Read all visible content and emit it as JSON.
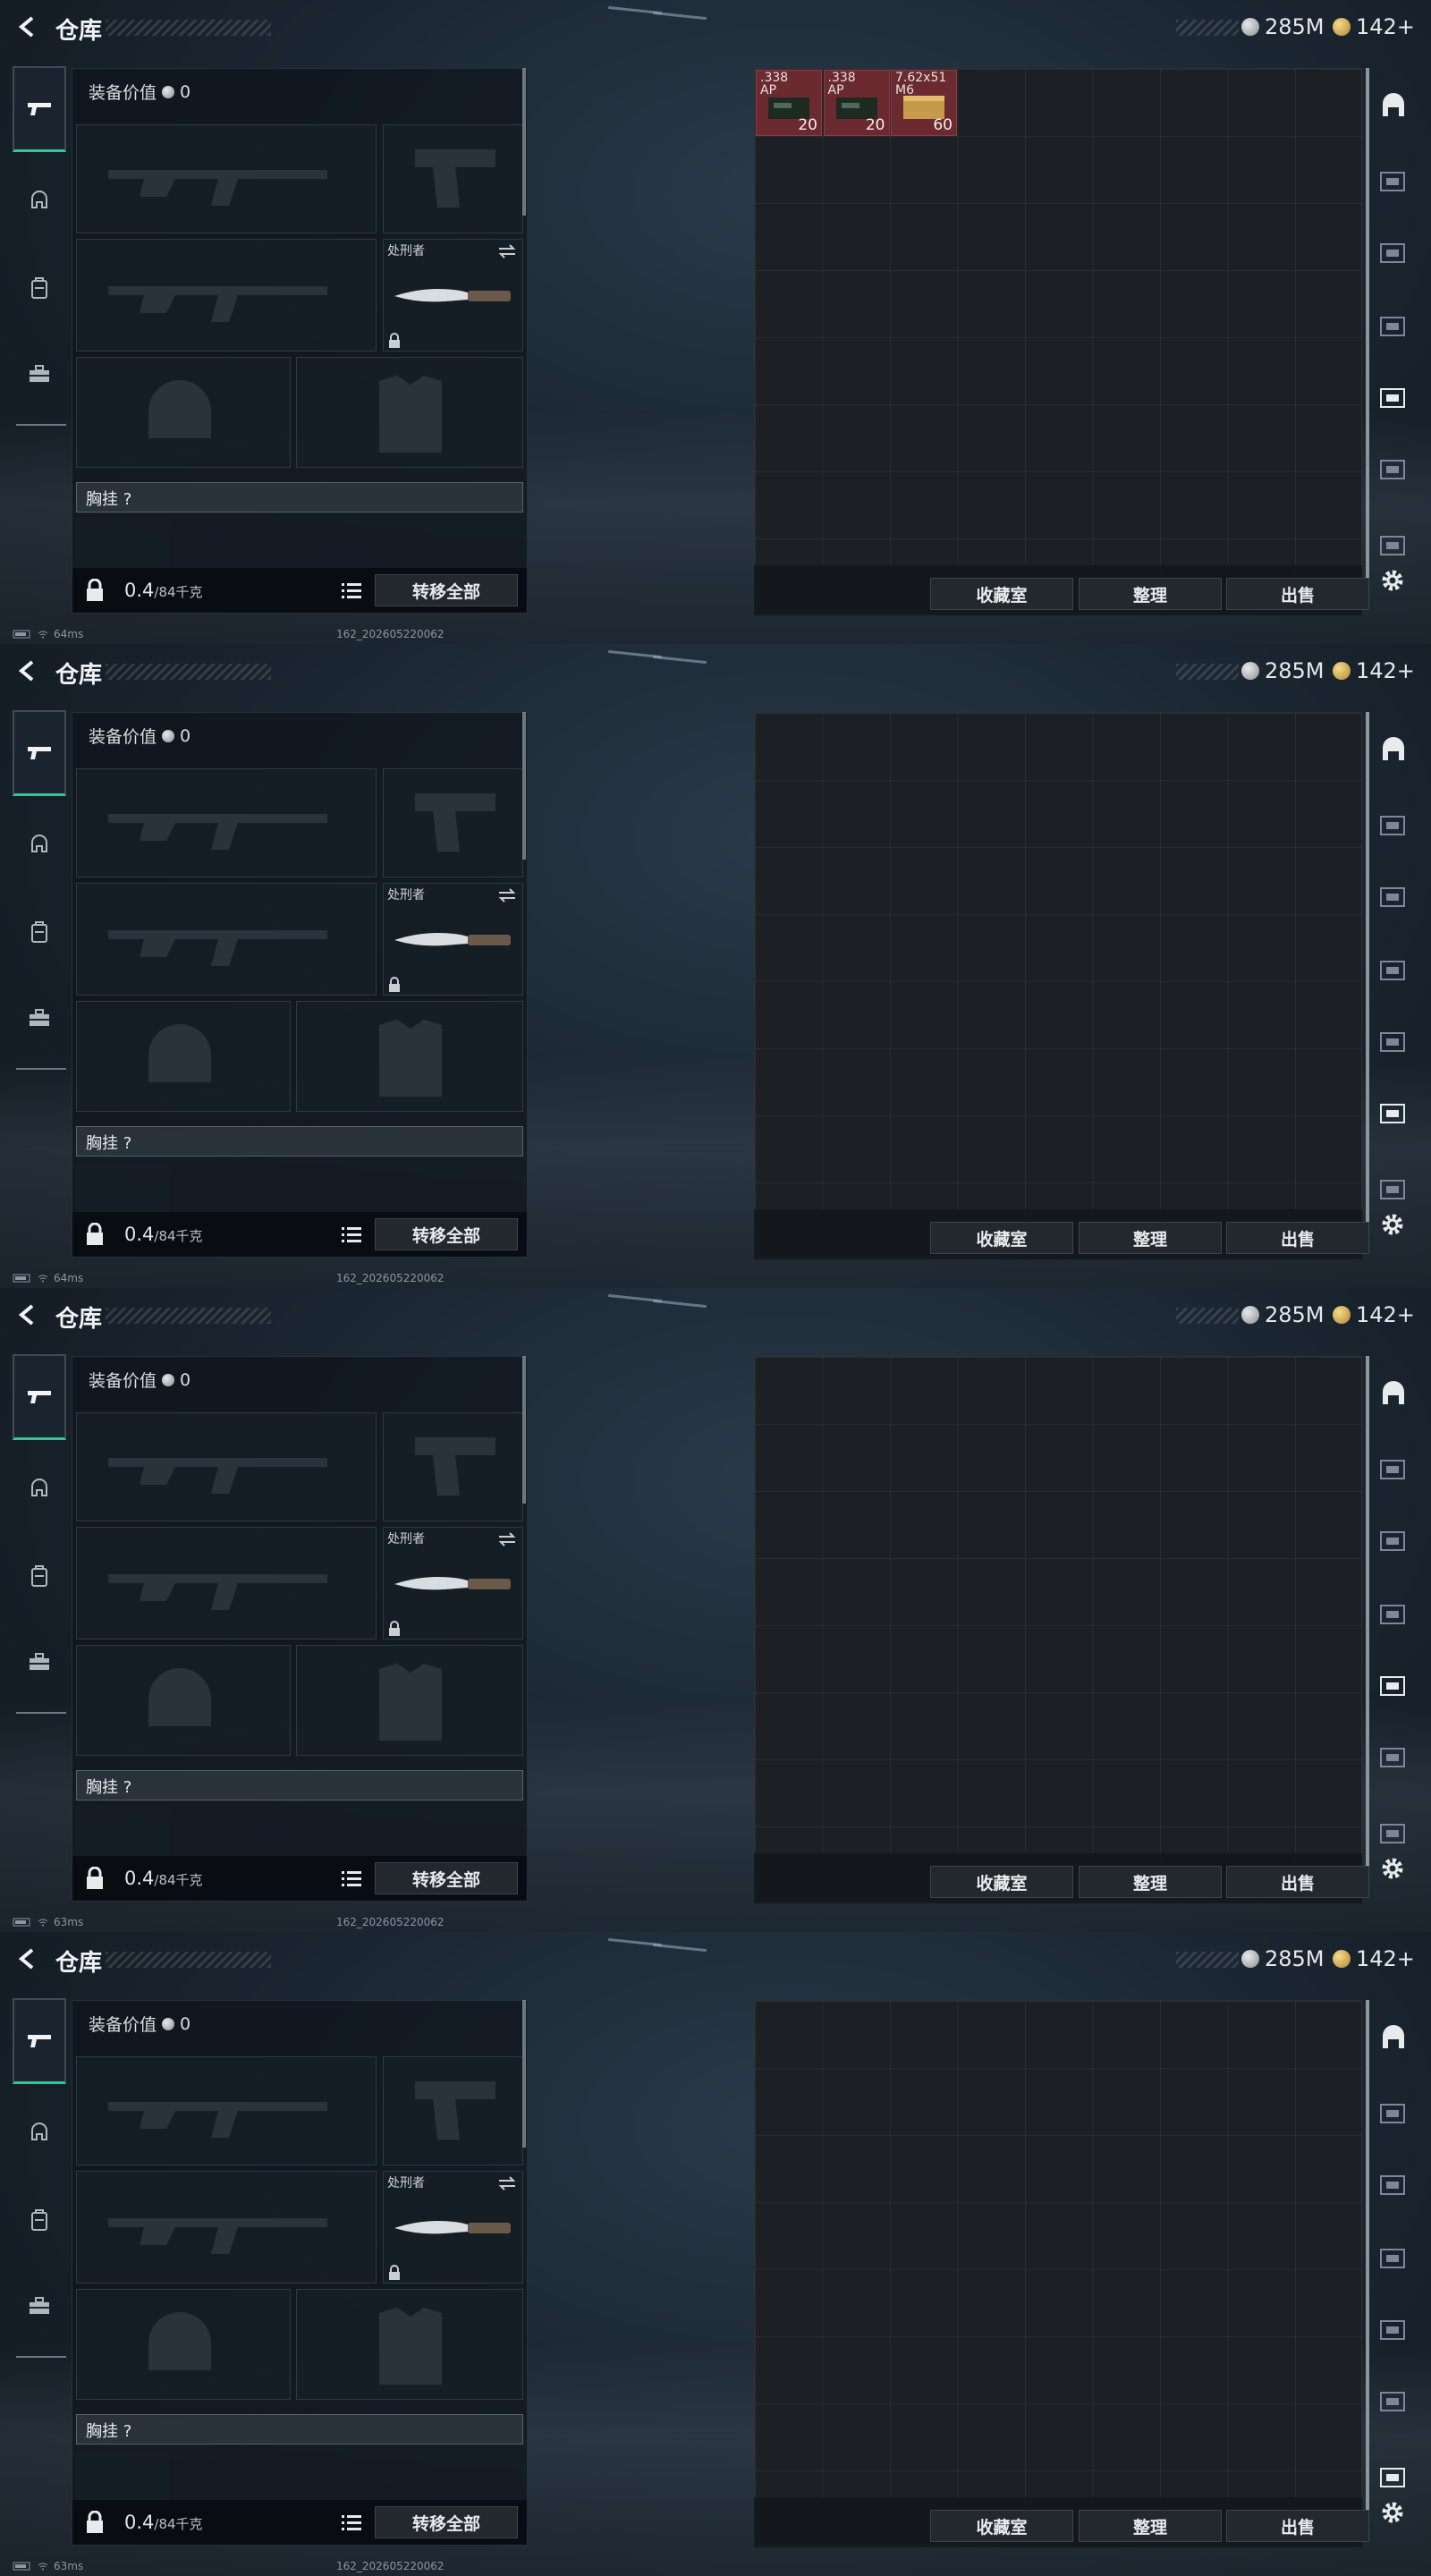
{
  "frames": [
    {
      "header": {
        "title": "仓库",
        "silver": "285M",
        "gold": "142+"
      },
      "loadout": {
        "equip_value_label": "装备价值",
        "equip_value": "0",
        "melee_label": "处刑者",
        "chest_label": "胸挂 ?",
        "weight": "0.4",
        "weight_max": "/84千克",
        "transfer_all": "转移全部"
      },
      "stash": {
        "btn_collection": "收藏室",
        "btn_sort": "整理",
        "btn_sell": "出售",
        "items": [
          {
            "caliber": ".338\nAP",
            "qty": "20"
          },
          {
            "caliber": ".338\nAP",
            "qty": "20"
          },
          {
            "caliber": "7.62x51\nM6",
            "qty": "60"
          }
        ]
      },
      "footer": {
        "ping": "64ms",
        "id": "162_202605220062"
      }
    },
    {
      "header": {
        "title": "仓库",
        "silver": "285M",
        "gold": "142+"
      },
      "loadout": {
        "equip_value_label": "装备价值",
        "equip_value": "0",
        "melee_label": "处刑者",
        "chest_label": "胸挂 ?",
        "weight": "0.4",
        "weight_max": "/84千克",
        "transfer_all": "转移全部"
      },
      "stash": {
        "btn_collection": "收藏室",
        "btn_sort": "整理",
        "btn_sell": "出售",
        "items": []
      },
      "footer": {
        "ping": "64ms",
        "id": "162_202605220062"
      }
    },
    {
      "header": {
        "title": "仓库",
        "silver": "285M",
        "gold": "142+"
      },
      "loadout": {
        "equip_value_label": "装备价值",
        "equip_value": "0",
        "melee_label": "处刑者",
        "chest_label": "胸挂 ?",
        "weight": "0.4",
        "weight_max": "/84千克",
        "transfer_all": "转移全部"
      },
      "stash": {
        "btn_collection": "收藏室",
        "btn_sort": "整理",
        "btn_sell": "出售",
        "items": []
      },
      "footer": {
        "ping": "63ms",
        "id": "162_202605220062"
      }
    },
    {
      "header": {
        "title": "仓库",
        "silver": "285M",
        "gold": "142+"
      },
      "loadout": {
        "equip_value_label": "装备价值",
        "equip_value": "0",
        "melee_label": "处刑者",
        "chest_label": "胸挂 ?",
        "weight": "0.4",
        "weight_max": "/84千克",
        "transfer_all": "转移全部"
      },
      "stash": {
        "btn_collection": "收藏室",
        "btn_sort": "整理",
        "btn_sell": "出售",
        "items": []
      },
      "footer": {
        "ping": "63ms",
        "id": "162_202605220062"
      }
    }
  ],
  "icons": {
    "rail": [
      "rifle-icon",
      "helmet-icon",
      "backpack-icon",
      "toolbox-icon"
    ],
    "right_rail": [
      "stash-tab-1-icon",
      "stash-tab-2-icon",
      "stash-tab-3-icon",
      "stash-tab-4-icon",
      "stash-tab-5-icon",
      "stash-tab-6-icon",
      "stash-tab-7-icon"
    ]
  },
  "colors": {
    "accent": "#3fbf94",
    "item_bg": "#6a2a30"
  }
}
